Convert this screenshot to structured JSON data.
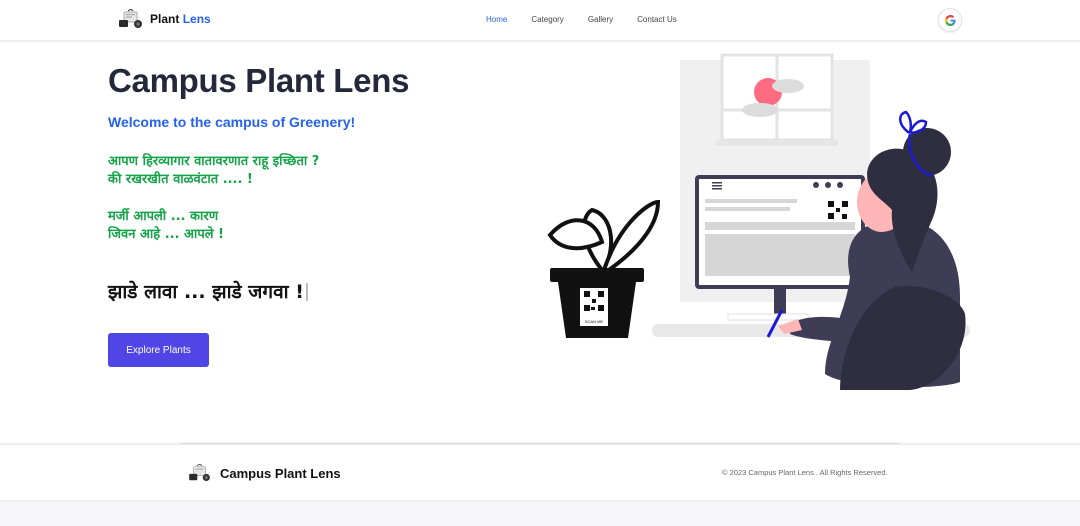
{
  "brand": {
    "name_part1": "Plant",
    "name_part2": "Lens"
  },
  "nav": {
    "items": [
      {
        "label": "Home",
        "active": true
      },
      {
        "label": "Category",
        "active": false
      },
      {
        "label": "Gallery",
        "active": false
      },
      {
        "label": "Contact Us",
        "active": false
      }
    ]
  },
  "auth": {
    "icon": "google-icon"
  },
  "hero": {
    "title": "Campus Plant Lens",
    "subtitle": "Welcome to the campus of Greenery!",
    "lines": [
      "आपण हिरव्यागार वातावरणात राहू इच्छिता ?",
      "की रखरखीत वाळवंटात .... !",
      "मर्जी आपली ... कारण",
      "जिवन आहे ... आपले !"
    ],
    "slogan": "झाडे लावा ... झाडे जगवा !",
    "cta_label": "Explore Plants",
    "illustration_text": "SCAN ME"
  },
  "footer": {
    "name": "Campus Plant Lens",
    "copyright": "© 2023 Campus Plant Lens . All Rights Reserved."
  },
  "colors": {
    "accent": "#2563eb",
    "green_text": "#16a34a",
    "button": "#4f46e5",
    "title": "#24283a"
  }
}
